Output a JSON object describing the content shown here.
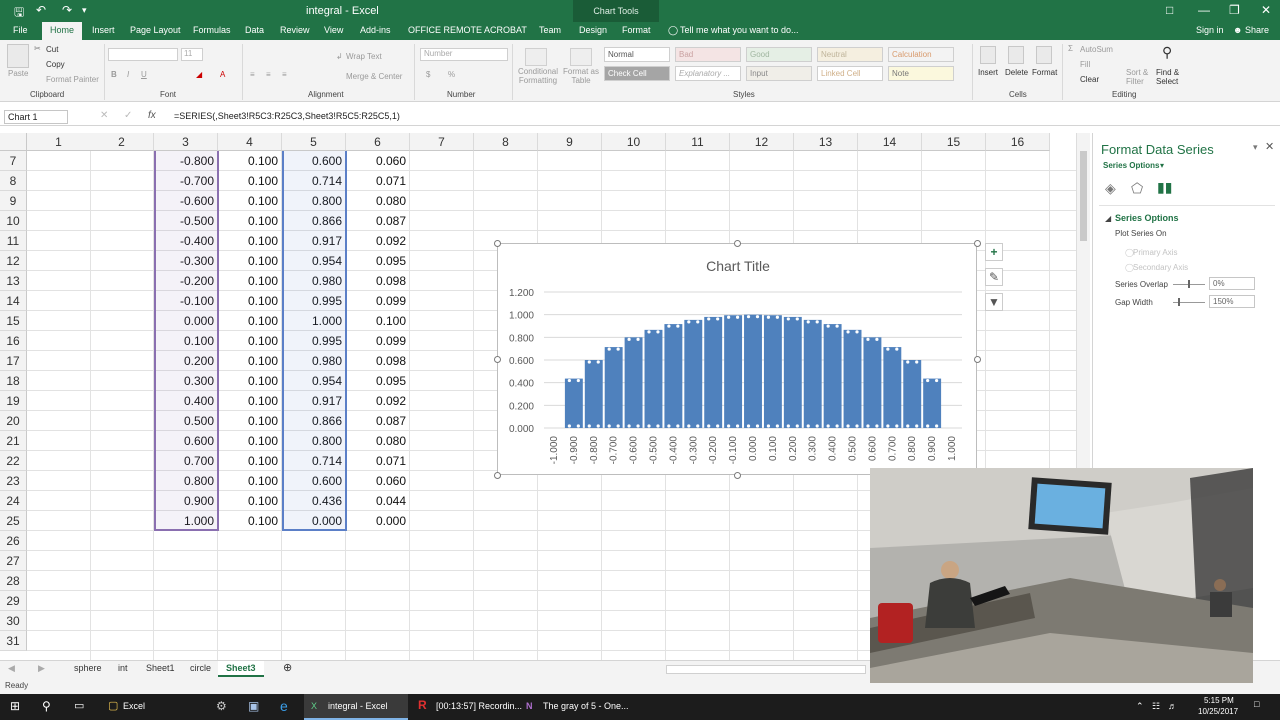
{
  "window": {
    "title": "integral - Excel",
    "chart_tools_label": "Chart Tools",
    "sign_in": "Sign in",
    "share": "Share"
  },
  "tabs": [
    "File",
    "Home",
    "Insert",
    "Page Layout",
    "Formulas",
    "Data",
    "Review",
    "View",
    "Add-ins",
    "OFFICE REMOTE",
    "ACROBAT",
    "Team",
    "Design",
    "Format"
  ],
  "tell_me": "Tell me what you want to do...",
  "ribbon": {
    "paste": "Paste",
    "cut": "Cut",
    "copy": "Copy",
    "format_painter": "Format Painter",
    "clipboard": "Clipboard",
    "font_name": "",
    "font_size": "11",
    "font": "Font",
    "wrap_text": "Wrap Text",
    "merge_center": "Merge & Center",
    "alignment": "Alignment",
    "number_format": "Number",
    "number": "Number",
    "cond_format": "Conditional Formatting",
    "format_as_table": "Format as Table",
    "styles_cells": [
      "Normal",
      "Bad",
      "Good",
      "Neutral",
      "Calculation",
      "Check Cell",
      "Explanatory ...",
      "Input",
      "Linked Cell",
      "Note"
    ],
    "styles": "Styles",
    "insert": "Insert",
    "delete": "Delete",
    "format": "Format",
    "cells": "Cells",
    "autosum": "AutoSum",
    "fill": "Fill",
    "clear": "Clear",
    "sort_filter": "Sort & Filter",
    "find_select": "Find & Select",
    "editing": "Editing"
  },
  "formula_bar": {
    "name_box": "Chart 1",
    "fx": "fx",
    "formula": "=SERIES(,Sheet3!R5C3:R25C3,Sheet3!R5C5:R25C5,1)"
  },
  "columns": [
    "1",
    "2",
    "3",
    "4",
    "5",
    "6",
    "7",
    "8",
    "9",
    "10",
    "11",
    "12",
    "13",
    "14",
    "15",
    "16"
  ],
  "rows": [
    {
      "n": "7",
      "c3": "-0.800",
      "c4": "0.100",
      "c5": "0.600",
      "c6": "0.060"
    },
    {
      "n": "8",
      "c3": "-0.700",
      "c4": "0.100",
      "c5": "0.714",
      "c6": "0.071"
    },
    {
      "n": "9",
      "c3": "-0.600",
      "c4": "0.100",
      "c5": "0.800",
      "c6": "0.080"
    },
    {
      "n": "10",
      "c3": "-0.500",
      "c4": "0.100",
      "c5": "0.866",
      "c6": "0.087"
    },
    {
      "n": "11",
      "c3": "-0.400",
      "c4": "0.100",
      "c5": "0.917",
      "c6": "0.092"
    },
    {
      "n": "12",
      "c3": "-0.300",
      "c4": "0.100",
      "c5": "0.954",
      "c6": "0.095"
    },
    {
      "n": "13",
      "c3": "-0.200",
      "c4": "0.100",
      "c5": "0.980",
      "c6": "0.098"
    },
    {
      "n": "14",
      "c3": "-0.100",
      "c4": "0.100",
      "c5": "0.995",
      "c6": "0.099"
    },
    {
      "n": "15",
      "c3": "0.000",
      "c4": "0.100",
      "c5": "1.000",
      "c6": "0.100"
    },
    {
      "n": "16",
      "c3": "0.100",
      "c4": "0.100",
      "c5": "0.995",
      "c6": "0.099"
    },
    {
      "n": "17",
      "c3": "0.200",
      "c4": "0.100",
      "c5": "0.980",
      "c6": "0.098"
    },
    {
      "n": "18",
      "c3": "0.300",
      "c4": "0.100",
      "c5": "0.954",
      "c6": "0.095"
    },
    {
      "n": "19",
      "c3": "0.400",
      "c4": "0.100",
      "c5": "0.917",
      "c6": "0.092"
    },
    {
      "n": "20",
      "c3": "0.500",
      "c4": "0.100",
      "c5": "0.866",
      "c6": "0.087"
    },
    {
      "n": "21",
      "c3": "0.600",
      "c4": "0.100",
      "c5": "0.800",
      "c6": "0.080"
    },
    {
      "n": "22",
      "c3": "0.700",
      "c4": "0.100",
      "c5": "0.714",
      "c6": "0.071"
    },
    {
      "n": "23",
      "c3": "0.800",
      "c4": "0.100",
      "c5": "0.600",
      "c6": "0.060"
    },
    {
      "n": "24",
      "c3": "0.900",
      "c4": "0.100",
      "c5": "0.436",
      "c6": "0.044"
    },
    {
      "n": "25",
      "c3": "1.000",
      "c4": "0.100",
      "c5": "0.000",
      "c6": "0.000"
    },
    {
      "n": "26",
      "c3": "",
      "c4": "",
      "c5": "",
      "c6": ""
    },
    {
      "n": "27",
      "c3": "",
      "c4": "",
      "c5": "",
      "c6": ""
    },
    {
      "n": "28",
      "c3": "",
      "c4": "",
      "c5": "",
      "c6": ""
    },
    {
      "n": "29",
      "c3": "",
      "c4": "",
      "c5": "",
      "c6": ""
    },
    {
      "n": "30",
      "c3": "",
      "c4": "",
      "c5": "",
      "c6": ""
    },
    {
      "n": "31",
      "c3": "",
      "c4": "",
      "c5": "",
      "c6": ""
    }
  ],
  "chart_data": {
    "type": "bar",
    "title": "Chart Title",
    "categories": [
      "-1.000",
      "-0.900",
      "-0.800",
      "-0.700",
      "-0.600",
      "-0.500",
      "-0.400",
      "-0.300",
      "-0.200",
      "-0.100",
      "0.000",
      "0.100",
      "0.200",
      "0.300",
      "0.400",
      "0.500",
      "0.600",
      "0.700",
      "0.800",
      "0.900",
      "1.000"
    ],
    "values": [
      0.0,
      0.436,
      0.6,
      0.714,
      0.8,
      0.866,
      0.917,
      0.954,
      0.98,
      0.995,
      1.0,
      0.995,
      0.98,
      0.954,
      0.917,
      0.866,
      0.8,
      0.714,
      0.6,
      0.436,
      0.0
    ],
    "yticks": [
      "0.000",
      "0.200",
      "0.400",
      "0.600",
      "0.800",
      "1.000",
      "1.200"
    ],
    "ylim": [
      0,
      1.2
    ],
    "xlabel": "",
    "ylabel": "",
    "grid": true,
    "bar_color": "#4f81bd"
  },
  "pane": {
    "title": "Format Data Series",
    "series_options_dropdown": "Series Options",
    "section": "Series Options",
    "plot_series_on": "Plot Series On",
    "primary_axis": "Primary Axis",
    "secondary_axis": "Secondary Axis",
    "series_overlap": "Series Overlap",
    "series_overlap_value": "0%",
    "gap_width": "Gap Width",
    "gap_width_value": "150%"
  },
  "sheets": [
    "sphere",
    "int",
    "Sheet1",
    "circle",
    "Sheet3"
  ],
  "active_sheet": "Sheet3",
  "status": "Ready",
  "taskbar": {
    "items": [
      "Excel",
      "integral - Excel",
      "[00:13:57] Recordin...",
      "The gray of 5 - One..."
    ],
    "time": "5:15 PM",
    "date": "10/25/2017"
  },
  "colors": {
    "excel_green": "#217346",
    "bar": "#4f81bd",
    "selection_purple": "#8a6fb0",
    "selection_blue": "#5b7fc7"
  }
}
